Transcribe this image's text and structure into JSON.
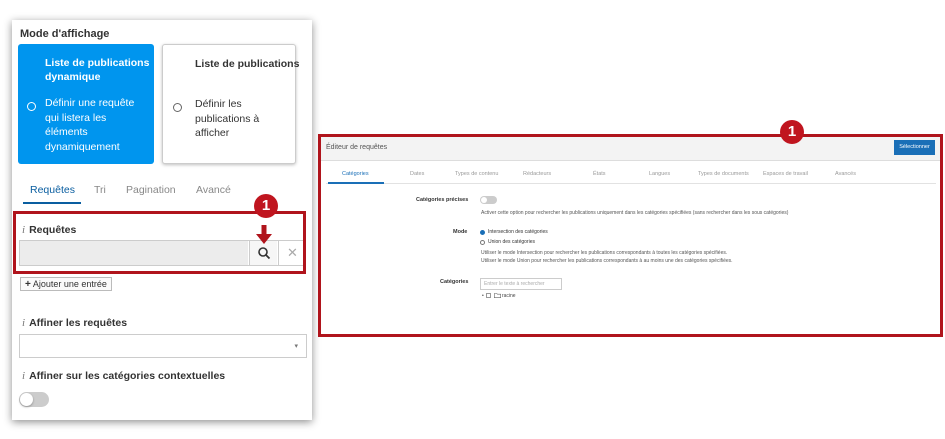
{
  "left_panel": {
    "title": "Mode d'affichage",
    "cards": [
      {
        "title": "Liste de publications dynamique",
        "description": "Définir une requête qui listera les éléments dynamiquement",
        "selected": true
      },
      {
        "title": "Liste de publications",
        "description": "Définir les publications à afficher",
        "selected": false
      }
    ],
    "tabs": [
      "Requêtes",
      "Tri",
      "Pagination",
      "Avancé"
    ],
    "active_tab": "Requêtes",
    "info_icon": "i",
    "requests_label": "Requêtes",
    "search_icon": "search-icon",
    "clear_glyph": "✕",
    "add_entry_plus": "+",
    "add_entry_label": "Ajouter une entrée",
    "refine_label": "Affiner les requêtes",
    "select_caret": "▾",
    "contextual_label": "Affiner sur les catégories contextuelles",
    "contextual_toggle_on": false
  },
  "callouts": [
    "1",
    "1"
  ],
  "colors": {
    "accent": "#0095ee",
    "highlight": "#b0141c",
    "callout": "#c0151f",
    "editor_accent": "#1a6fb7"
  },
  "editor": {
    "title": "Éditeur de requêtes",
    "select_button": "Sélectionner",
    "tabs": [
      "Catégories",
      "Dates",
      "Types de contenu",
      "Rédacteurs",
      "États",
      "Langues",
      "Types de documents",
      "Espaces de travail",
      "Avancés"
    ],
    "active_tab": "Catégories",
    "precise": {
      "label": "Catégories précises",
      "help": "Activer cette option pour rechercher les publications uniquement dans les catégories spécifiées (sans rechercher dans les sous catégories)",
      "toggle_on": false
    },
    "mode": {
      "label": "Mode",
      "options": [
        "Intersection des catégories",
        "Union des catégories"
      ],
      "selected": "Intersection des catégories",
      "help_1": "Utiliser le mode Intersection pour rechercher les publications correspondants à toutes les catégories spécifiées.",
      "help_2": "Utiliser le mode Union pour rechercher les publications correspondants à au moins une des catégories spécifiées."
    },
    "categories": {
      "label": "Catégories",
      "placeholder": "Entrer le texte à rechercher",
      "tree_root": "racine"
    }
  }
}
